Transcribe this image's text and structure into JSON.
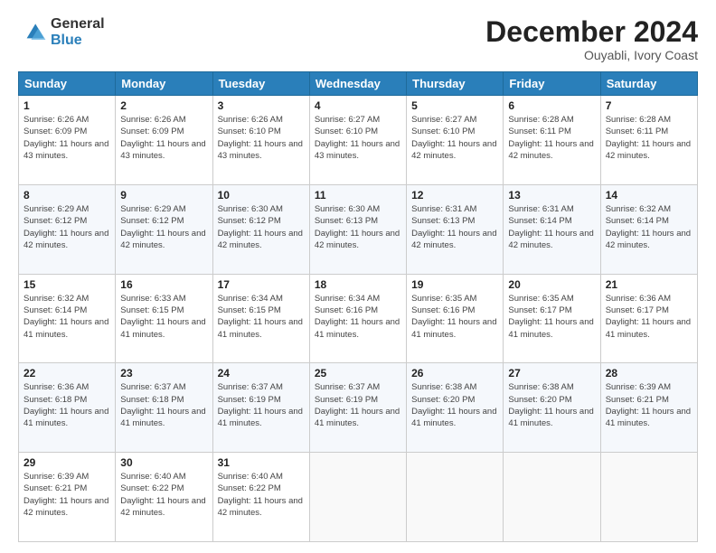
{
  "logo": {
    "general": "General",
    "blue": "Blue"
  },
  "header": {
    "month_title": "December 2024",
    "subtitle": "Ouyabli, Ivory Coast"
  },
  "days_of_week": [
    "Sunday",
    "Monday",
    "Tuesday",
    "Wednesday",
    "Thursday",
    "Friday",
    "Saturday"
  ],
  "weeks": [
    [
      {
        "day": 1,
        "sunrise": "6:26 AM",
        "sunset": "6:09 PM",
        "daylight": "11 hours and 43 minutes."
      },
      {
        "day": 2,
        "sunrise": "6:26 AM",
        "sunset": "6:09 PM",
        "daylight": "11 hours and 43 minutes."
      },
      {
        "day": 3,
        "sunrise": "6:26 AM",
        "sunset": "6:10 PM",
        "daylight": "11 hours and 43 minutes."
      },
      {
        "day": 4,
        "sunrise": "6:27 AM",
        "sunset": "6:10 PM",
        "daylight": "11 hours and 43 minutes."
      },
      {
        "day": 5,
        "sunrise": "6:27 AM",
        "sunset": "6:10 PM",
        "daylight": "11 hours and 42 minutes."
      },
      {
        "day": 6,
        "sunrise": "6:28 AM",
        "sunset": "6:11 PM",
        "daylight": "11 hours and 42 minutes."
      },
      {
        "day": 7,
        "sunrise": "6:28 AM",
        "sunset": "6:11 PM",
        "daylight": "11 hours and 42 minutes."
      }
    ],
    [
      {
        "day": 8,
        "sunrise": "6:29 AM",
        "sunset": "6:12 PM",
        "daylight": "11 hours and 42 minutes."
      },
      {
        "day": 9,
        "sunrise": "6:29 AM",
        "sunset": "6:12 PM",
        "daylight": "11 hours and 42 minutes."
      },
      {
        "day": 10,
        "sunrise": "6:30 AM",
        "sunset": "6:12 PM",
        "daylight": "11 hours and 42 minutes."
      },
      {
        "day": 11,
        "sunrise": "6:30 AM",
        "sunset": "6:13 PM",
        "daylight": "11 hours and 42 minutes."
      },
      {
        "day": 12,
        "sunrise": "6:31 AM",
        "sunset": "6:13 PM",
        "daylight": "11 hours and 42 minutes."
      },
      {
        "day": 13,
        "sunrise": "6:31 AM",
        "sunset": "6:14 PM",
        "daylight": "11 hours and 42 minutes."
      },
      {
        "day": 14,
        "sunrise": "6:32 AM",
        "sunset": "6:14 PM",
        "daylight": "11 hours and 42 minutes."
      }
    ],
    [
      {
        "day": 15,
        "sunrise": "6:32 AM",
        "sunset": "6:14 PM",
        "daylight": "11 hours and 41 minutes."
      },
      {
        "day": 16,
        "sunrise": "6:33 AM",
        "sunset": "6:15 PM",
        "daylight": "11 hours and 41 minutes."
      },
      {
        "day": 17,
        "sunrise": "6:34 AM",
        "sunset": "6:15 PM",
        "daylight": "11 hours and 41 minutes."
      },
      {
        "day": 18,
        "sunrise": "6:34 AM",
        "sunset": "6:16 PM",
        "daylight": "11 hours and 41 minutes."
      },
      {
        "day": 19,
        "sunrise": "6:35 AM",
        "sunset": "6:16 PM",
        "daylight": "11 hours and 41 minutes."
      },
      {
        "day": 20,
        "sunrise": "6:35 AM",
        "sunset": "6:17 PM",
        "daylight": "11 hours and 41 minutes."
      },
      {
        "day": 21,
        "sunrise": "6:36 AM",
        "sunset": "6:17 PM",
        "daylight": "11 hours and 41 minutes."
      }
    ],
    [
      {
        "day": 22,
        "sunrise": "6:36 AM",
        "sunset": "6:18 PM",
        "daylight": "11 hours and 41 minutes."
      },
      {
        "day": 23,
        "sunrise": "6:37 AM",
        "sunset": "6:18 PM",
        "daylight": "11 hours and 41 minutes."
      },
      {
        "day": 24,
        "sunrise": "6:37 AM",
        "sunset": "6:19 PM",
        "daylight": "11 hours and 41 minutes."
      },
      {
        "day": 25,
        "sunrise": "6:37 AM",
        "sunset": "6:19 PM",
        "daylight": "11 hours and 41 minutes."
      },
      {
        "day": 26,
        "sunrise": "6:38 AM",
        "sunset": "6:20 PM",
        "daylight": "11 hours and 41 minutes."
      },
      {
        "day": 27,
        "sunrise": "6:38 AM",
        "sunset": "6:20 PM",
        "daylight": "11 hours and 41 minutes."
      },
      {
        "day": 28,
        "sunrise": "6:39 AM",
        "sunset": "6:21 PM",
        "daylight": "11 hours and 41 minutes."
      }
    ],
    [
      {
        "day": 29,
        "sunrise": "6:39 AM",
        "sunset": "6:21 PM",
        "daylight": "11 hours and 42 minutes."
      },
      {
        "day": 30,
        "sunrise": "6:40 AM",
        "sunset": "6:22 PM",
        "daylight": "11 hours and 42 minutes."
      },
      {
        "day": 31,
        "sunrise": "6:40 AM",
        "sunset": "6:22 PM",
        "daylight": "11 hours and 42 minutes."
      },
      null,
      null,
      null,
      null
    ]
  ]
}
